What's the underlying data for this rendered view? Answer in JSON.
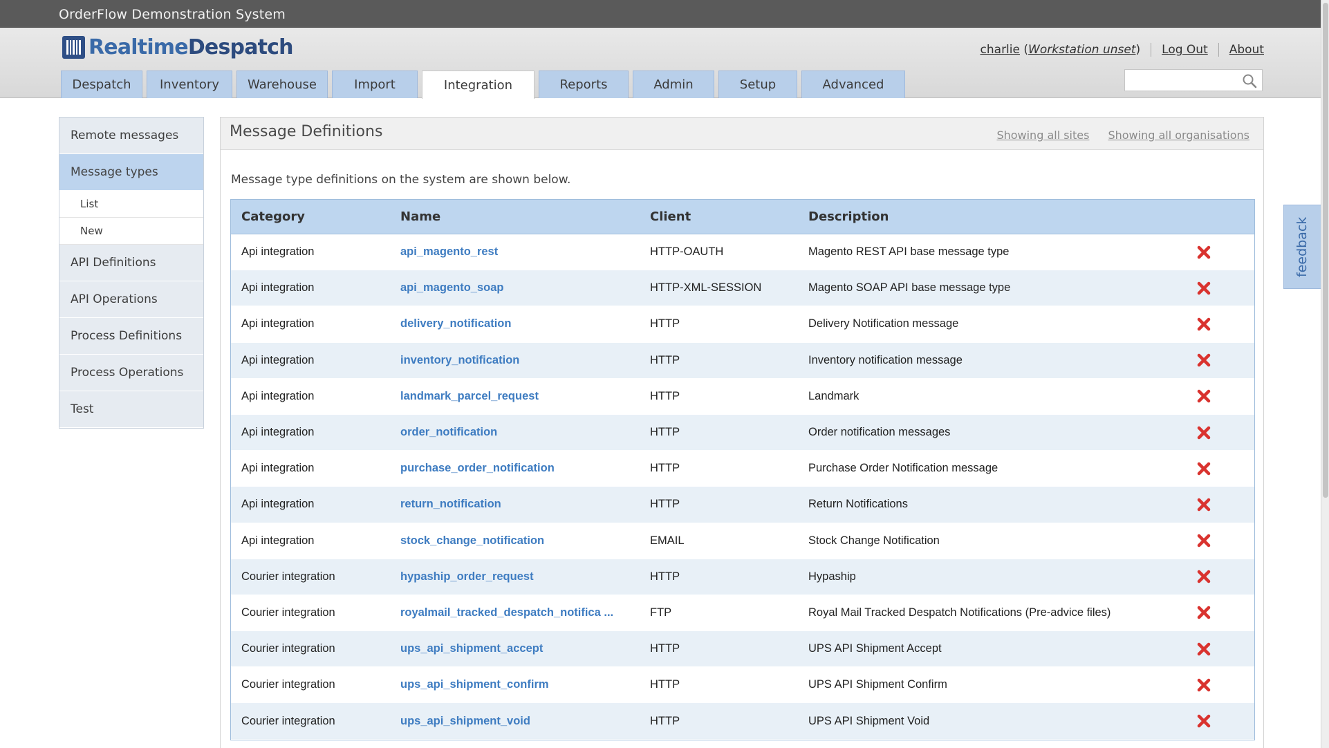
{
  "window": {
    "title": "OrderFlow Demonstration System"
  },
  "brand": {
    "logo_part1": "Realtime",
    "logo_part2": "Despatch"
  },
  "user": {
    "name": "charlie",
    "workstation": "Workstation unset",
    "logout": "Log Out",
    "about": "About"
  },
  "nav": {
    "tabs": [
      {
        "label": "Despatch"
      },
      {
        "label": "Inventory"
      },
      {
        "label": "Warehouse"
      },
      {
        "label": "Import"
      },
      {
        "label": "Integration"
      },
      {
        "label": "Reports"
      },
      {
        "label": "Admin"
      },
      {
        "label": "Setup"
      },
      {
        "label": "Advanced"
      }
    ],
    "active": "Integration",
    "search_placeholder": ""
  },
  "sidebar": {
    "items": [
      {
        "label": "Remote messages"
      },
      {
        "label": "Message types"
      },
      {
        "label": "List"
      },
      {
        "label": "New"
      },
      {
        "label": "API Definitions"
      },
      {
        "label": "API Operations"
      },
      {
        "label": "Process Definitions"
      },
      {
        "label": "Process Operations"
      },
      {
        "label": "Test"
      }
    ]
  },
  "main": {
    "title": "Message Definitions",
    "filter_sites": "Showing all sites",
    "filter_orgs": "Showing all organisations",
    "intro": "Message type definitions on the system are shown below.",
    "columns": [
      "Category",
      "Name",
      "Client",
      "Description"
    ],
    "rows": [
      [
        "Api integration",
        "api_magento_rest",
        "HTTP-OAUTH",
        "Magento REST API base message type"
      ],
      [
        "Api integration",
        "api_magento_soap",
        "HTTP-XML-SESSION",
        "Magento SOAP API base message type"
      ],
      [
        "Api integration",
        "delivery_notification",
        "HTTP",
        "Delivery Notification message"
      ],
      [
        "Api integration",
        "inventory_notification",
        "HTTP",
        "Inventory notification message"
      ],
      [
        "Api integration",
        "landmark_parcel_request",
        "HTTP",
        "Landmark"
      ],
      [
        "Api integration",
        "order_notification",
        "HTTP",
        "Order notification messages"
      ],
      [
        "Api integration",
        "purchase_order_notification",
        "HTTP",
        "Purchase Order Notification message"
      ],
      [
        "Api integration",
        "return_notification",
        "HTTP",
        "Return Notifications"
      ],
      [
        "Api integration",
        "stock_change_notification",
        "EMAIL",
        "Stock Change Notification"
      ],
      [
        "Courier integration",
        "hypaship_order_request",
        "HTTP",
        "Hypaship"
      ],
      [
        "Courier integration",
        "royalmail_tracked_despatch_notifica ...",
        "FTP",
        "Royal Mail Tracked Despatch Notifications (Pre-advice files)"
      ],
      [
        "Courier integration",
        "ups_api_shipment_accept",
        "HTTP",
        "UPS API Shipment Accept"
      ],
      [
        "Courier integration",
        "ups_api_shipment_confirm",
        "HTTP",
        "UPS API Shipment Confirm"
      ],
      [
        "Courier integration",
        "ups_api_shipment_void",
        "HTTP",
        "UPS API Shipment Void"
      ]
    ]
  },
  "feedback": {
    "label": "feedback"
  },
  "colors": {
    "tab": "#b8cfea",
    "link": "#3e7cc1",
    "delete": "#d9332f",
    "header_row": "#bed6ef",
    "alt_row": "#e8f0f7"
  },
  "icons": {
    "delete": "red-x-icon",
    "search": "magnifier-icon"
  }
}
